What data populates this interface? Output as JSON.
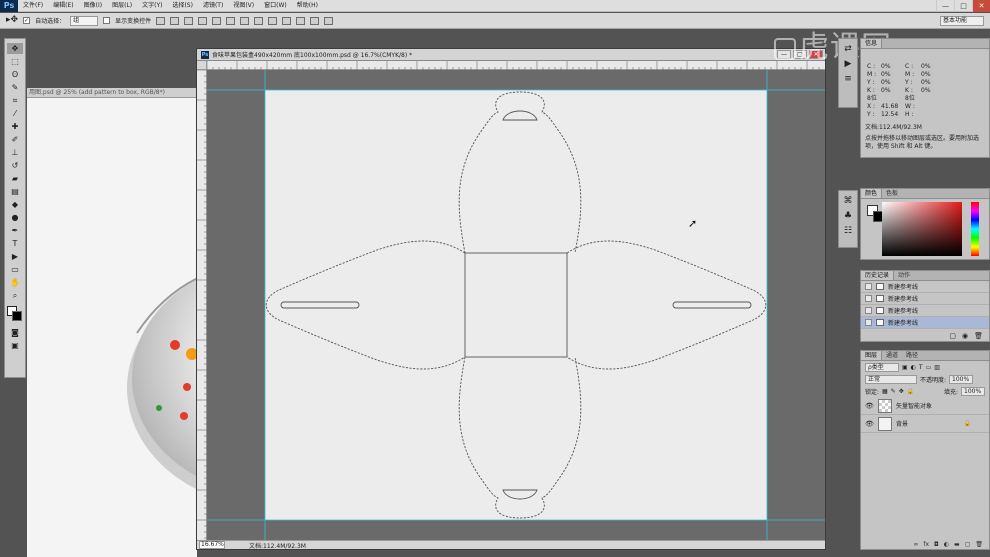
{
  "app": {
    "logo": "Ps"
  },
  "menu": [
    "文件(F)",
    "编辑(E)",
    "图像(I)",
    "图层(L)",
    "文字(Y)",
    "选择(S)",
    "滤镜(T)",
    "视图(V)",
    "窗口(W)",
    "帮助(H)"
  ],
  "window_controls": {
    "minimize": "—",
    "maximize": "□",
    "close": "✕"
  },
  "options_bar": {
    "auto_select_label": "自动选择：",
    "auto_select_value": "组",
    "show_transform_label": "显示变换控件",
    "workspace": "基本功能"
  },
  "background_doc": {
    "title": "用图.psd @ 25% (add pattern to box, RGB/8*)"
  },
  "document": {
    "title": "食味苹果包装盒490x420mm 底100x100mm.psd @ 16.7%(CMYK/8) *",
    "zoom": "16.67%",
    "status": "文档:112.4M/92.3M"
  },
  "watermark": "虎课网",
  "info_panel": {
    "tabs": [
      "信息"
    ],
    "rows": [
      [
        "C :",
        "0%",
        "C :",
        "0%",
        ""
      ],
      [
        "M :",
        "0%",
        "M :",
        "0%",
        ""
      ],
      [
        "Y :",
        "0%",
        "Y :",
        "0%",
        ""
      ],
      [
        "K :",
        "0%",
        "K :",
        "0%",
        ""
      ],
      [
        "8位",
        "",
        "8位",
        "",
        ""
      ],
      [
        "X :",
        "41.68",
        "W :",
        "",
        ""
      ],
      [
        "Y :",
        "12.54",
        "H :",
        "",
        ""
      ]
    ],
    "doc_size": "文档:112.4M/92.3M",
    "hint": "点按并拖移以移动图层或选区。要用附加选项，使用 Shift 和 Alt 键。"
  },
  "color_panel": {
    "tabs": [
      "颜色",
      "色板"
    ]
  },
  "history_panel": {
    "tabs": [
      "历史记录",
      "动作"
    ],
    "items": [
      "新建参考线",
      "新建参考线",
      "新建参考线",
      "新建参考线"
    ],
    "selected_index": 3
  },
  "layers_panel": {
    "tabs": [
      "图层",
      "通道",
      "路径"
    ],
    "kind_filter": "ρ类型",
    "blend_mode": "正常",
    "opacity_label": "不透明度:",
    "opacity_value": "100%",
    "lock_label": "锁定:",
    "fill_label": "填充:",
    "fill_value": "100%",
    "layers": [
      {
        "name": "矢量智能对象",
        "type": "smart-object"
      },
      {
        "name": "背景",
        "type": "background",
        "locked": true
      }
    ],
    "footer_icons": [
      "link-icon",
      "fx-icon",
      "mask-icon",
      "adjustment-icon",
      "group-icon",
      "new-layer-icon",
      "trash-icon"
    ]
  },
  "colors": {
    "workspace_bg": "#535353",
    "canvas": "#ececec",
    "guide": "#2fc4d6",
    "dieline": "#555555"
  },
  "tools": [
    "move-tool",
    "marquee-tool",
    "lasso-tool",
    "quick-select-tool",
    "crop-tool",
    "eyedropper-tool",
    "healing-brush-tool",
    "brush-tool",
    "clone-stamp-tool",
    "history-brush-tool",
    "eraser-tool",
    "gradient-tool",
    "blur-tool",
    "dodge-tool",
    "pen-tool",
    "type-tool",
    "path-select-tool",
    "shape-tool",
    "hand-tool",
    "zoom-tool"
  ]
}
